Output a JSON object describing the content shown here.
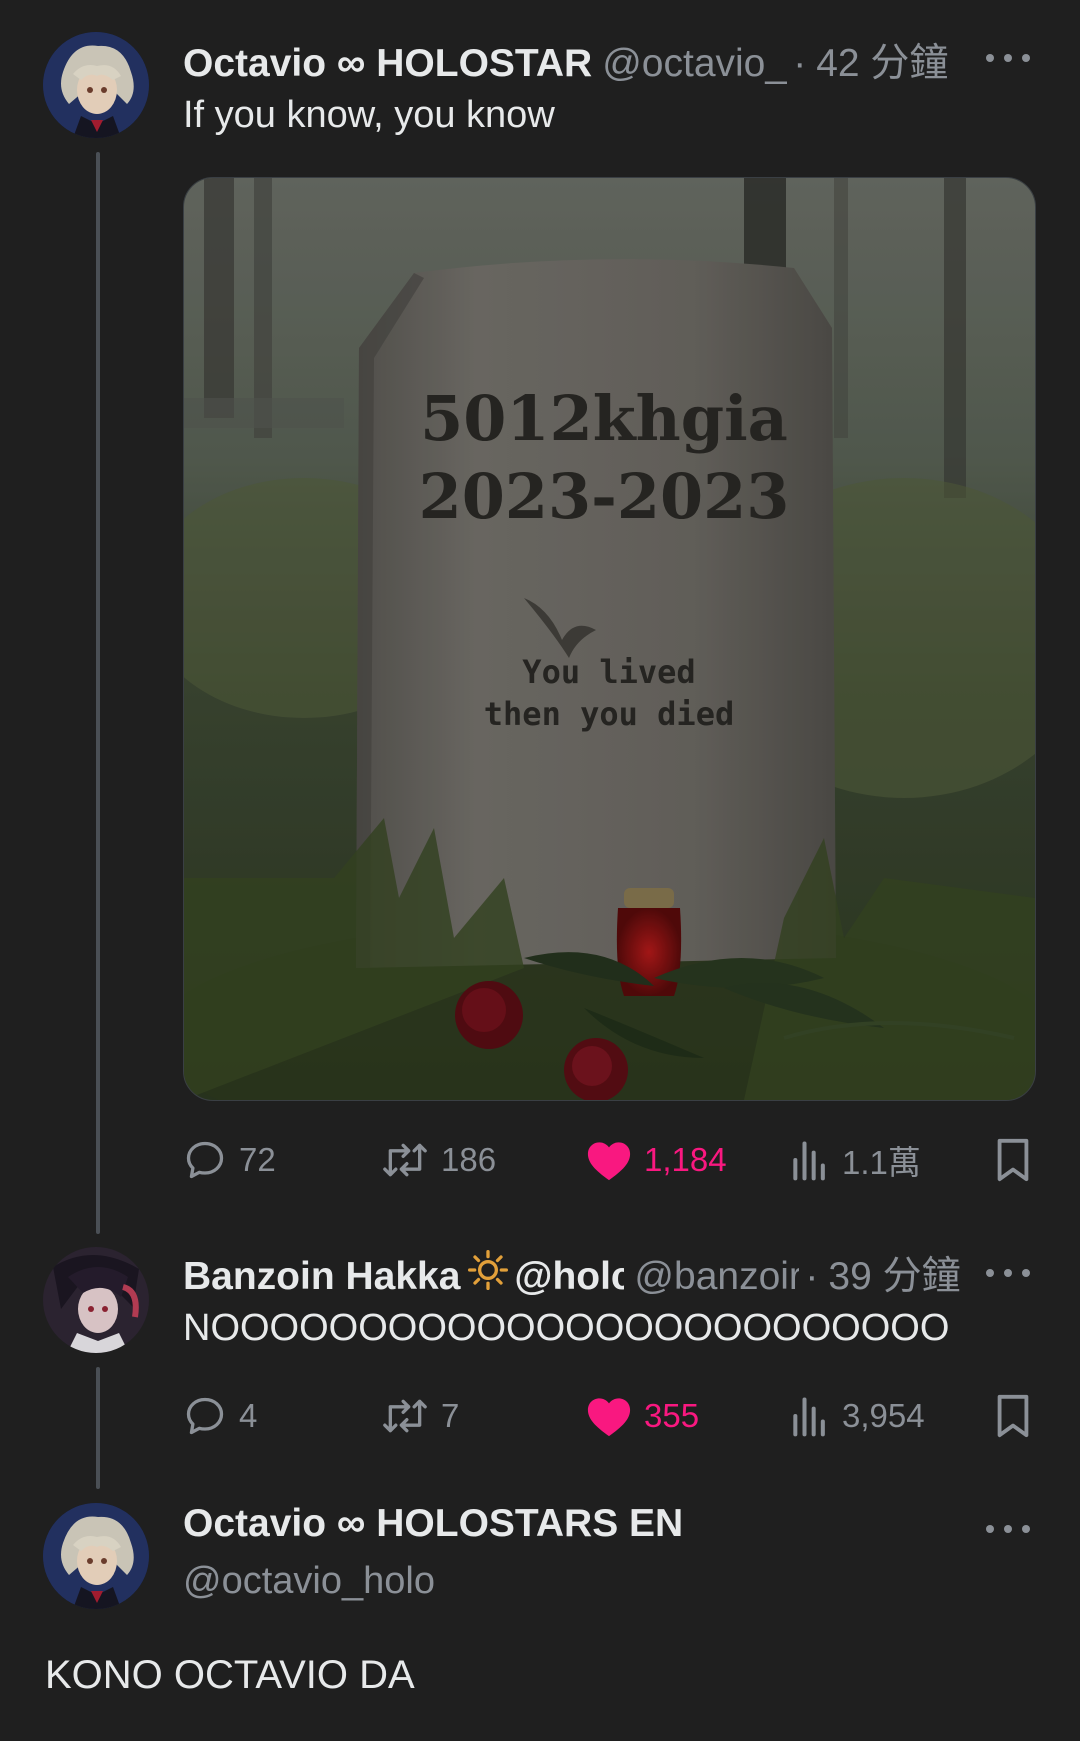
{
  "tweets": [
    {
      "name": "Octavio",
      "name_suffix": "HOLOSTAR",
      "handle": "@octavio_l",
      "time": "42 分鐘",
      "text": "If you know, you know",
      "image": {
        "line1": "5012khgia",
        "line2": "2023-2023",
        "epitaph1": "You lived",
        "epitaph2": "then you died"
      },
      "stats": {
        "replies": "72",
        "reposts": "186",
        "likes": "1,184",
        "views": "1.1萬"
      }
    },
    {
      "name": "Banzoin Hakka",
      "name_extra": "@holc",
      "handle": "@banzoir",
      "time": "39 分鐘",
      "text": "NOOOOOOOOOOOOOOOOOOOOOOOOO",
      "stats": {
        "replies": "4",
        "reposts": "7",
        "likes": "355",
        "views": "3,954"
      }
    },
    {
      "name": "Octavio",
      "name_suffix": "HOLOSTARS EN",
      "handle": "@octavio_holo",
      "text": "KONO OCTAVIO DA"
    }
  ],
  "separator_dot": "·",
  "colors": {
    "background": "#1f1f1f",
    "text": "#e7e9ea",
    "muted": "#8b9097",
    "like": "#f91880"
  }
}
